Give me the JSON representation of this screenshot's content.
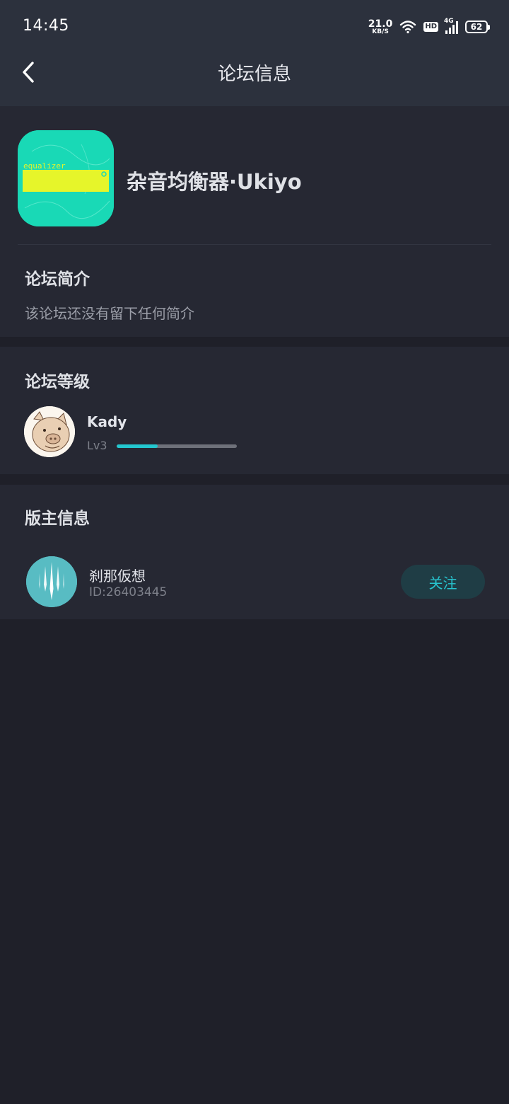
{
  "status_bar": {
    "time": "14:45",
    "net_speed": "21.0",
    "net_unit": "KB/S",
    "hd": "HD",
    "network": "4G",
    "battery": "62"
  },
  "nav": {
    "title": "论坛信息"
  },
  "forum": {
    "name": "杂音均衡器·Ukiyo",
    "icon_text": "equalizer",
    "icon_color": "#19d9b6",
    "icon_accent": "#e6f52a"
  },
  "intro": {
    "title": "论坛简介",
    "text": "该论坛还没有留下任何简介"
  },
  "level": {
    "title": "论坛等级",
    "user_name": "Kady",
    "level_label": "Lv3",
    "progress": 0.34
  },
  "moderator": {
    "title": "版主信息",
    "name": "刹那仮想",
    "id": "ID:26403445",
    "follow_label": "关注"
  },
  "colors": {
    "accent": "#27c4cf",
    "background": "#1f2029",
    "card": "#262833",
    "header": "#2c313d"
  }
}
